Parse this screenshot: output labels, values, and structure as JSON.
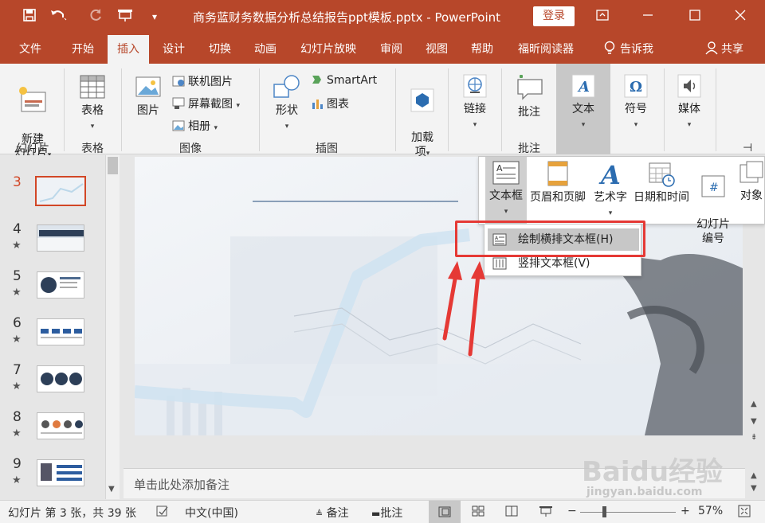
{
  "titlebar": {
    "document_title": "商务蓝财务数据分析总结报告ppt模板.pptx  -  PowerPoint",
    "login_label": "登录"
  },
  "tabs": [
    {
      "label": "文件"
    },
    {
      "label": "开始"
    },
    {
      "label": "插入",
      "active": true
    },
    {
      "label": "设计"
    },
    {
      "label": "切换"
    },
    {
      "label": "动画"
    },
    {
      "label": "幻灯片放映"
    },
    {
      "label": "审阅"
    },
    {
      "label": "视图"
    },
    {
      "label": "帮助"
    },
    {
      "label": "福昕阅读器"
    },
    {
      "label": "告诉我"
    },
    {
      "label": "共享"
    }
  ],
  "ribbon": {
    "new_slide": "新建\n幻灯片",
    "group_slides": "幻灯片",
    "table": "表格",
    "group_table": "表格",
    "picture": "图片",
    "online_picture": "联机图片",
    "screenshot": "屏幕截图",
    "album": "相册",
    "group_images": "图像",
    "shapes": "形状",
    "smartart": "SmartArt",
    "chart": "图表",
    "group_illustrations": "插图",
    "addins": "加载\n项",
    "link": "链接",
    "comment": "批注",
    "group_comments": "批注",
    "text": "文本",
    "symbols": "符号",
    "media": "媒体"
  },
  "text_dropdown": {
    "items": [
      "文本框",
      "页眉和页脚",
      "艺术字",
      "日期和时间",
      "幻灯片\n编号",
      "对象"
    ]
  },
  "textbox_menu": {
    "items": [
      {
        "label": "绘制横排文本框(H)",
        "highlighted": true
      },
      {
        "label": "竖排文本框(V)"
      }
    ]
  },
  "slides_pane": {
    "numbers": [
      "3",
      "4",
      "5",
      "6",
      "7",
      "8",
      "9"
    ],
    "active": "3"
  },
  "notes_placeholder": "单击此处添加备注",
  "statusbar": {
    "slide_info": "幻灯片 第 3 张，共 39 张",
    "language": "中文(中国)",
    "notes": "备注",
    "comments": "批注",
    "zoom": "57%"
  },
  "watermark": {
    "brand": "Baidu经验",
    "url": "jingyan.baidu.com"
  },
  "colors": {
    "accent": "#b7472a",
    "annotation": "#e53935"
  }
}
